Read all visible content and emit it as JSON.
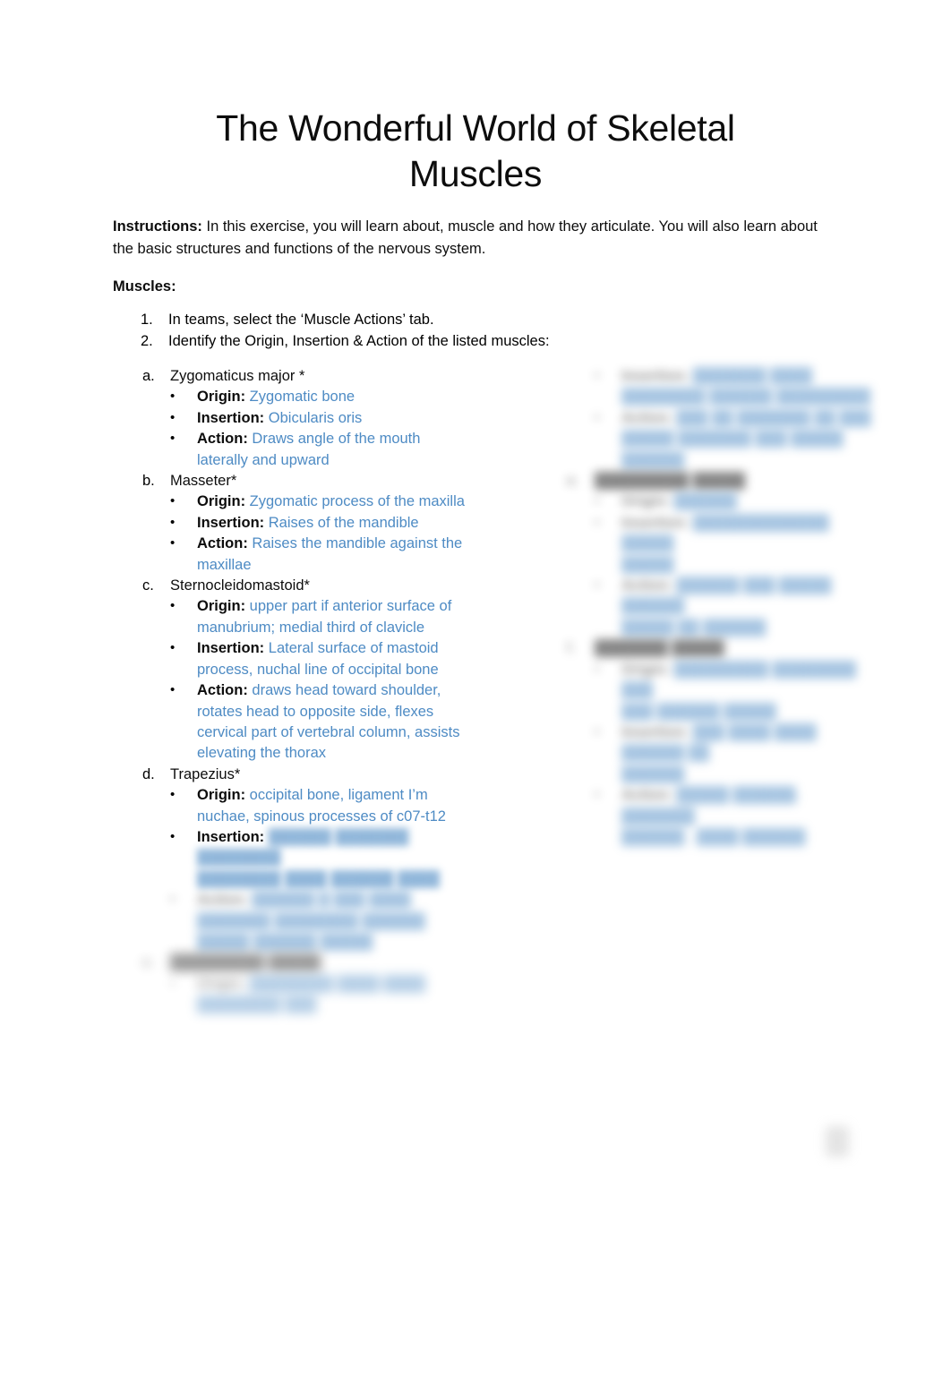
{
  "document": {
    "title_line1": "The Wonderful World of Skeletal",
    "title_line2": "Muscles",
    "instructions_label": "Instructions:",
    "instructions_text": " In this exercise, you will learn about, muscle and how they articulate. You will also learn about the basic structures and functions of the nervous system.",
    "muscles_heading": "Muscles:"
  },
  "colors": {
    "blue_text": "#4e8bc4",
    "body_text": "#0d0d0d",
    "page_background": "#ffffff"
  },
  "numbered_list": [
    {
      "marker": "1.",
      "text": "In teams, select the ‘Muscle Actions’ tab."
    },
    {
      "marker": "2.",
      "text": " Identify the Origin, Insertion & Action of the listed muscles:"
    }
  ],
  "labels": {
    "origin": "Origin:",
    "insertion": "Insertion:",
    "action": "Action:"
  },
  "muscles_left": [
    {
      "marker": "a.",
      "name": "Zygomaticus major *",
      "origin": "Zygomatic bone",
      "insertion": "Obicularis  oris",
      "action": "Draws angle of the mouth laterally and upward"
    },
    {
      "marker": "b.",
      "name": "Masseter*",
      "origin": "Zygomatic process of the maxilla",
      "insertion": "Raises of the mandible",
      "action": "Raises the mandible against the maxillae"
    },
    {
      "marker": "c.",
      "name": "Sternocleidomastoid*",
      "origin": "upper part if anterior surface of manubrium; medial third of clavicle",
      "insertion": "Lateral surface of mastoid process, nuchal line of occipital bone",
      "action": "draws head toward shoulder, rotates head to opposite side, flexes cervical part of vertebral column, assists elevating the thorax"
    },
    {
      "marker": "d.",
      "name": "Trapezius*",
      "origin": "occipital bone, ligament I’m nuchae, spinous processes of c07-t12",
      "insertion": "",
      "action": ""
    }
  ],
  "obscured_left": {
    "trapezius_insertion_value": "██████ ███████ ████████",
    "trapezius_insertion_line2": "████████ ████ ██████ ████",
    "action_label": "Action:",
    "action_line1": "██████ █ ███ ████",
    "action_line2": "███████ ████████ ██████",
    "action_line3": "█████ ██████ █████",
    "next_item_marker": "e.",
    "next_item_name": "█████████ █████",
    "next_origin_label": "Origin:",
    "next_origin_line1": "████████ ████ ████",
    "next_origin_line2": "████████ ███"
  },
  "obscured_right": [
    {
      "bullet_label": "Insertion:",
      "lines": [
        "███████ ████",
        "████████ ██████ █████████"
      ]
    },
    {
      "bullet_label": "Action:",
      "lines": [
        "███ ██ ███████ ██ ███",
        "█████ ███████ ███ █████",
        "██████"
      ]
    }
  ],
  "obscured_right_items": [
    {
      "marker": "e.",
      "name": "█████████ █████",
      "rows": [
        {
          "label": "Origin:",
          "lines": [
            "██████"
          ]
        },
        {
          "label": "Insertion:",
          "lines": [
            "█████████████ █████",
            "█████"
          ]
        },
        {
          "label": "Action:",
          "lines": [
            "██████ ███ █████ ██████",
            "█████ ██ ██████"
          ]
        }
      ]
    },
    {
      "marker": "f.",
      "name": "███████ █████",
      "rows": [
        {
          "label": "Origin:",
          "lines": [
            "█████████ ████████ ███",
            "███ ██████ █████"
          ]
        },
        {
          "label": "Insertion:",
          "lines": [
            "███ ████ ████ ██████ ██",
            "██████"
          ]
        },
        {
          "label": "Action:",
          "lines": [
            "█████ ██████, ███████",
            "██████ , ████ ██████"
          ]
        }
      ]
    }
  ]
}
